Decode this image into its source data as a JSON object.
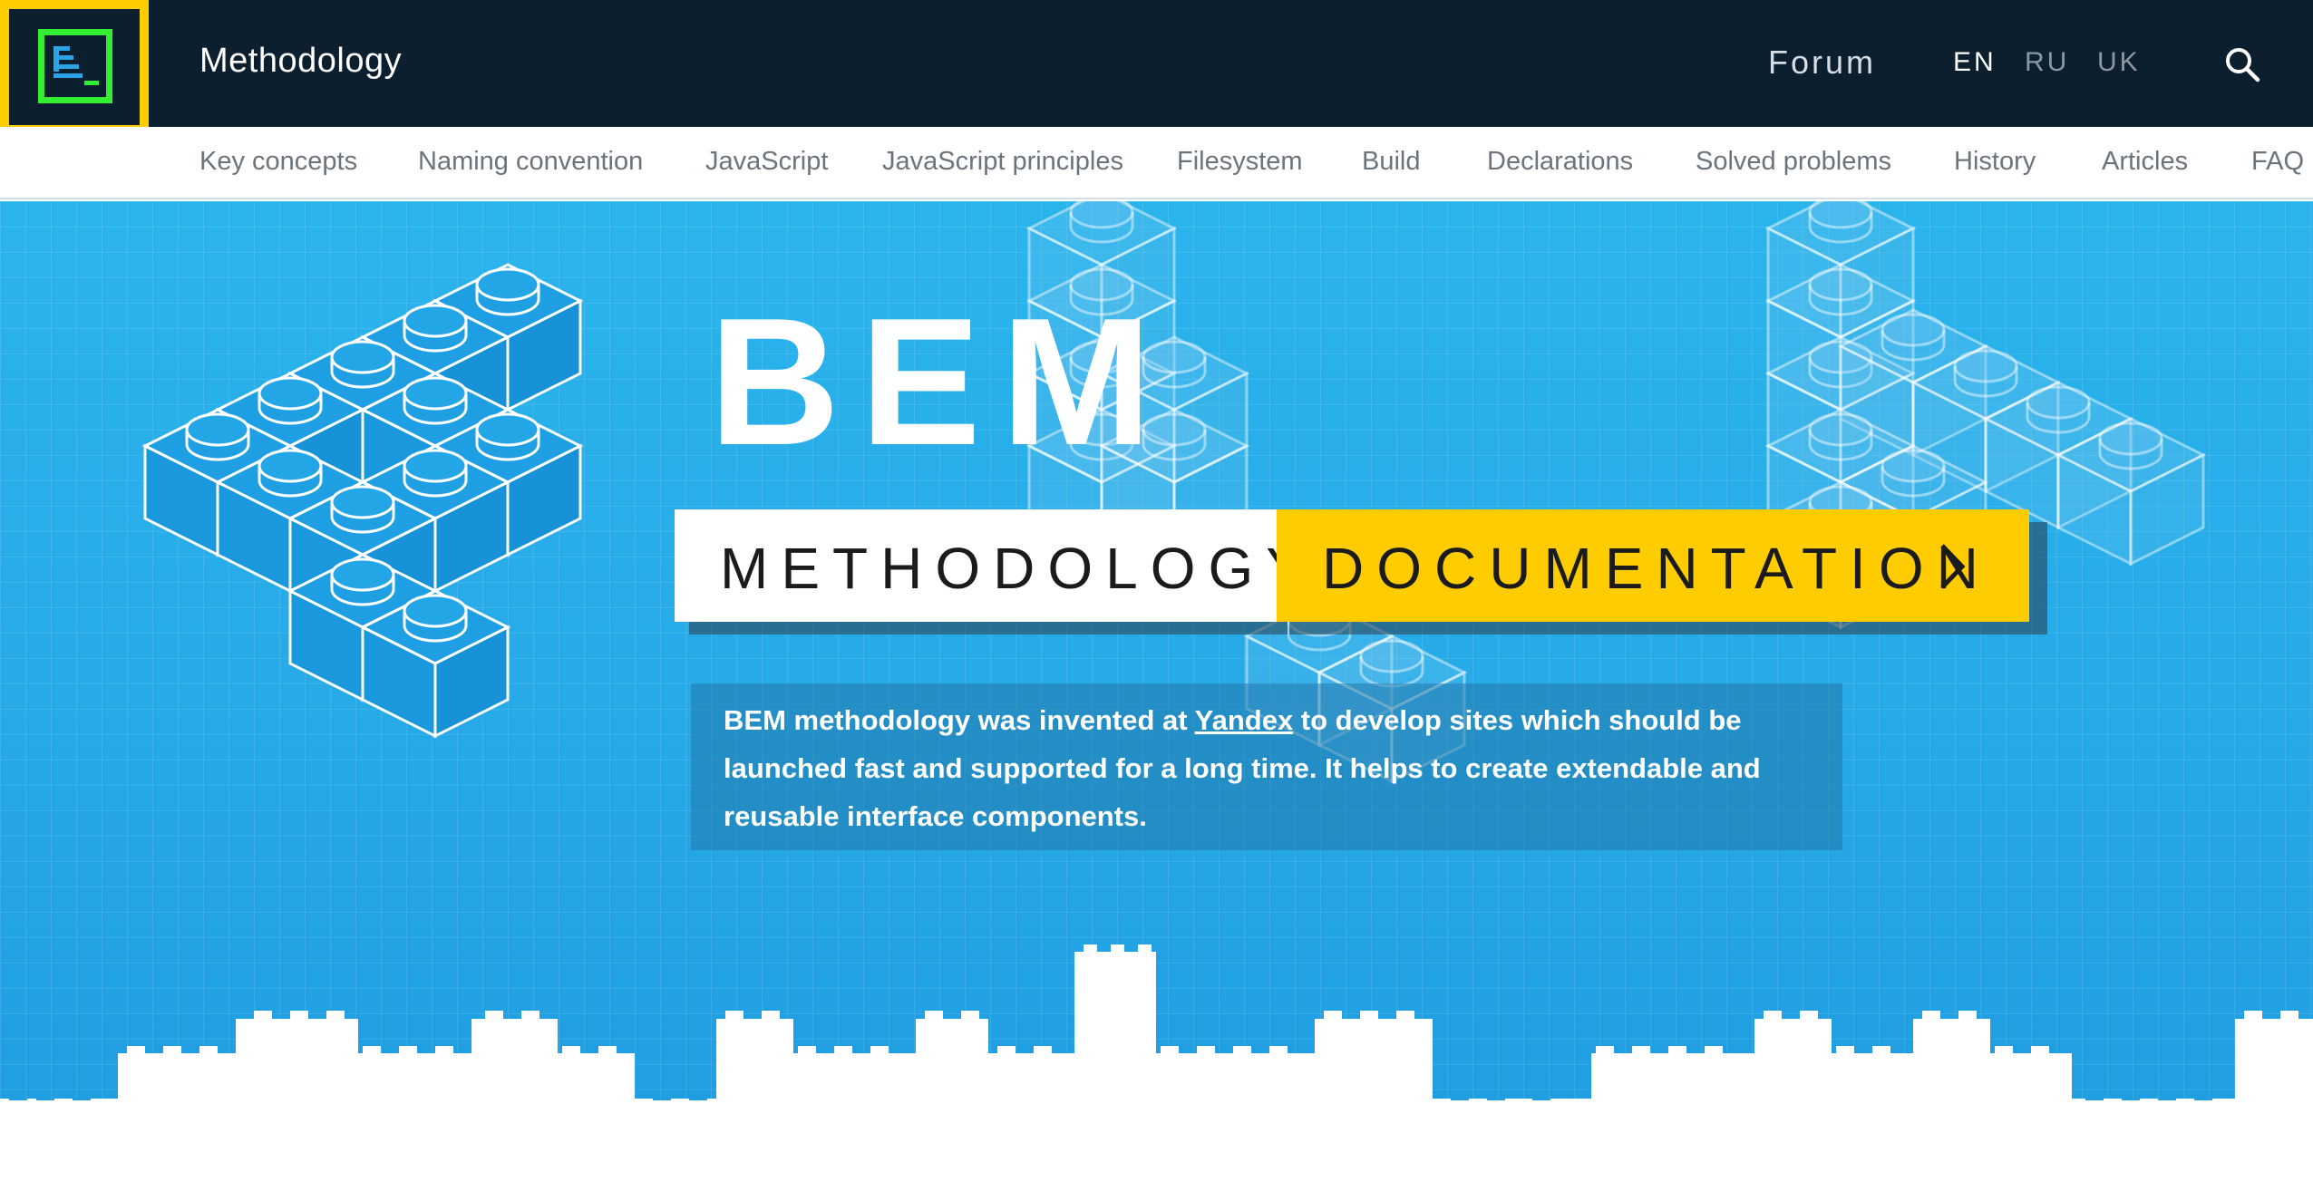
{
  "header": {
    "app_title": "Methodology",
    "logo_icon": "bem-logo-icon",
    "forum_label": "Forum",
    "languages": [
      {
        "code": "EN",
        "active": true
      },
      {
        "code": "RU",
        "active": false
      },
      {
        "code": "UK",
        "active": false
      }
    ],
    "search_icon": "search-icon",
    "colors": {
      "background": "#0c1f2f",
      "logo_border": "#ffcc00",
      "logo_accent": "#33ee33"
    }
  },
  "nav": {
    "items": [
      "Key concepts",
      "Naming convention",
      "JavaScript",
      "JavaScript principles",
      "Filesystem",
      "Build",
      "Declarations",
      "Solved problems",
      "History",
      "Articles",
      "FAQ"
    ]
  },
  "hero": {
    "title": "BEM",
    "tag_left": "METHODOLOGY",
    "tag_right": "DOCUMENTATION",
    "tag_right_icon": "chevron-right-icon",
    "description": {
      "bold_lead": "BEM",
      "part1": " methodology was invented at ",
      "link": "Yandex",
      "part2": " to develop sites which should be launched fast and supported for a long time. It helps to create extendable and reusable interface components."
    },
    "colors": {
      "background": "#26aae8",
      "accent": "#ffcc00"
    }
  }
}
